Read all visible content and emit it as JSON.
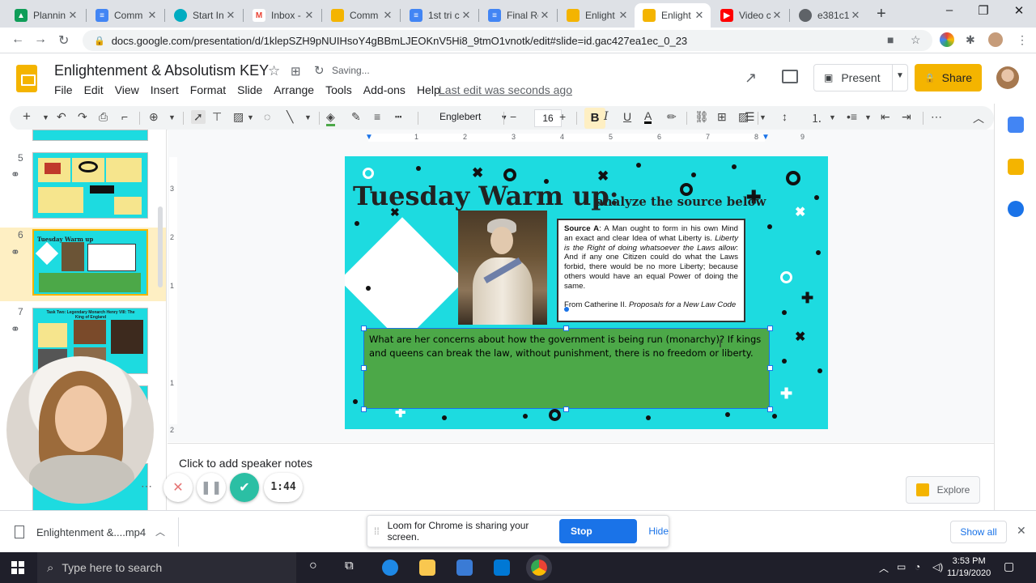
{
  "browser": {
    "tabs": [
      {
        "title": "Plannin",
        "color": "#0f9d58"
      },
      {
        "title": "Comm",
        "color": "#4285f4"
      },
      {
        "title": "Start In",
        "color": "#00acc1"
      },
      {
        "title": "Inbox -",
        "color": "#ea4335"
      },
      {
        "title": "Comm",
        "color": "#f4b400"
      },
      {
        "title": "1st tri c",
        "color": "#4285f4"
      },
      {
        "title": "Final Re",
        "color": "#4285f4"
      },
      {
        "title": "Enlight",
        "color": "#f4b400"
      },
      {
        "title": "Enlight",
        "color": "#f4b400"
      },
      {
        "title": "Video c",
        "color": "#ff0000"
      },
      {
        "title": "e381c1",
        "color": "#5f6368"
      }
    ],
    "url": "docs.google.com/presentation/d/1klepSZH9pNUIHsoY4gBBmLJEOKnV5Hi8_9tmO1vnotk/edit#slide=id.gac427ea1ec_0_23"
  },
  "app": {
    "title": "Enlightenment & Absolutism KEY",
    "saving": "Saving...",
    "menu": [
      "File",
      "Edit",
      "View",
      "Insert",
      "Format",
      "Slide",
      "Arrange",
      "Tools",
      "Add-ons",
      "Help"
    ],
    "last_edit": "Last edit was seconds ago",
    "present_label": "Present",
    "share_label": "Share",
    "accent": "#f4b400"
  },
  "toolbar": {
    "font": "Englebert",
    "font_size": "16",
    "bold": "B",
    "italic": "I",
    "underline": "U",
    "text_color": "A"
  },
  "filmstrip": {
    "slides": [
      {
        "num": "5"
      },
      {
        "num": "6"
      },
      {
        "num": "7"
      }
    ],
    "slide7_title": "Task Two: Legendary Monarch Henry VIII: The King of England"
  },
  "ruler": {
    "h_ticks": [
      "1",
      "2",
      "3",
      "4",
      "5",
      "6",
      "7",
      "8",
      "9"
    ],
    "v_ticks": [
      "3",
      "2",
      "1",
      "1",
      "2"
    ]
  },
  "slide": {
    "title": "Tuesday Warm up:",
    "subtitle": "analyze the source below",
    "source_label": "Source A",
    "source_text": ": A Man ought to form in his own Mind an exact and clear Idea of what Liberty is.",
    "source_italic": "Liberty is the Right of doing whatsoever the Laws allow",
    "source_text2": ": And if any one Citizen could do what the Laws forbid, there would be no more Liberty; because others would have an equal Power of doing the same.",
    "cite_prefix": "From Catherine II.",
    "cite_italic": "Proposals for a New Law Code",
    "answer": "What are her concerns about how the government is being run (monarchy)? If kings and queens can break the law, without punishment, there is no freedom or liberty.",
    "bg_color": "#1ddbe0",
    "answer_color": "#4ca848"
  },
  "notes": {
    "placeholder": "Click to add speaker notes"
  },
  "explore": {
    "label": "Explore"
  },
  "loom": {
    "timer": "1:44",
    "sharing_text": "Loom for Chrome is sharing your screen.",
    "stop_label": "Stop sharing",
    "hide_label": "Hide"
  },
  "downloads": {
    "file": "Enlightenment &....mp4",
    "show_all": "Show all"
  },
  "taskbar": {
    "search_placeholder": "Type here to search",
    "time": "3:53 PM",
    "date": "11/19/2020"
  }
}
